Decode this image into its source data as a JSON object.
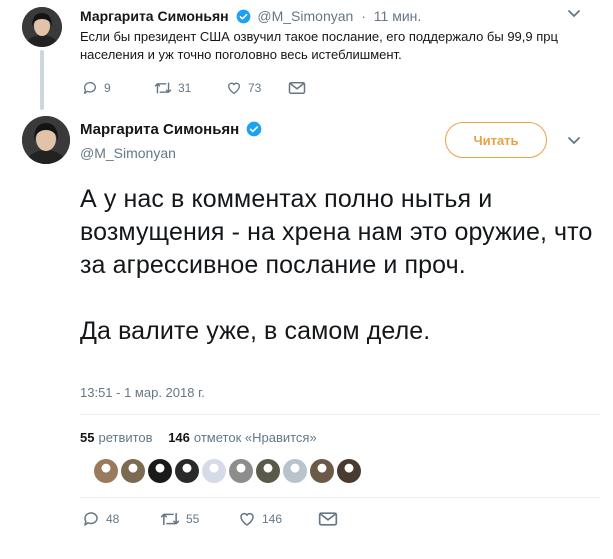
{
  "parent_tweet": {
    "author_name": "Маргарита Симоньян",
    "handle": "@M_Simonyan",
    "separator": "·",
    "time": "11 мин.",
    "text": "Если бы президент США озвучил такое послание, его поддержало бы 99,9 прц населения и уж точно поголовно весь истеблишмент.",
    "replies": "9",
    "retweets": "31",
    "likes": "73"
  },
  "main_tweet": {
    "author_name": "Маргарита Симоньян",
    "handle": "@M_Simonyan",
    "follow_label": "Читать",
    "text_line1": "А у нас в комментах полно нытья и возмущения - на хрена нам это оружие, что за агрессивное послание и проч.",
    "text_line2": "Да валите уже, в самом деле.",
    "timestamp": "13:51 - 1 мар. 2018 г.",
    "retweet_count": "55",
    "retweet_label": "ретвитов",
    "like_count": "146",
    "like_label": "отметок «Нравится»",
    "replies": "48",
    "retweets": "55",
    "likes": "146"
  },
  "colors": {
    "verified": "#1da1f2",
    "follow_accent": "#e8a246",
    "muted": "#657786"
  },
  "likers": [
    {
      "icon": "avatar-1",
      "color": "#9a7a5c"
    },
    {
      "icon": "avatar-2",
      "color": "#7c6a52"
    },
    {
      "icon": "avatar-3",
      "color": "#1a1a1a"
    },
    {
      "icon": "avatar-4",
      "color": "#2a2a2a"
    },
    {
      "icon": "avatar-5",
      "color": "#d7dbe8"
    },
    {
      "icon": "avatar-6",
      "color": "#8d8d8d"
    },
    {
      "icon": "avatar-7",
      "color": "#5a5a4a"
    },
    {
      "icon": "avatar-8",
      "color": "#b9c3cc"
    },
    {
      "icon": "avatar-9",
      "color": "#6b5a48"
    },
    {
      "icon": "avatar-10",
      "color": "#4a3b30"
    }
  ]
}
